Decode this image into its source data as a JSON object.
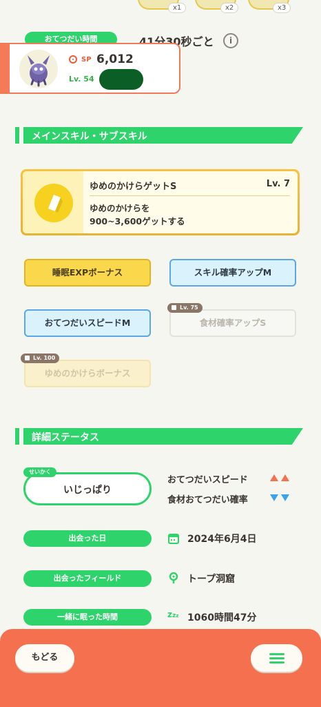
{
  "top": {
    "multipliers": [
      "x1",
      "x2",
      "x3"
    ],
    "help_label": "おてつだい時間",
    "help_value": "41分30秒ごと"
  },
  "pokemon": {
    "sp_label": "SP",
    "sp_value": "6,012",
    "level": "Lv. 54"
  },
  "skills_section": {
    "title": "メインスキル・サブスキル",
    "main_skill": {
      "name": "ゆめのかけらゲットS",
      "level": "Lv. 7",
      "desc_line1": "ゆめのかけらを",
      "desc_line2": "900~3,600ゲットする"
    },
    "sub_skills": [
      {
        "label": "睡眠EXPボーナス"
      },
      {
        "label": "スキル確率アップM"
      },
      {
        "label": "おてつだいスピードM"
      },
      {
        "label": "食材確率アップS",
        "lock": "Lv. 75"
      },
      {
        "label": "ゆめのかけらボーナス",
        "lock": "Lv. 100"
      }
    ]
  },
  "details": {
    "title": "詳細ステータス",
    "nature_tag": "せいかく",
    "nature": "いじっぱり",
    "nature_up": "おてつだいスピード",
    "nature_down": "食材おてつだい確率",
    "rows": [
      {
        "label": "出会った日",
        "value": "2024年6月4日"
      },
      {
        "label": "出会ったフィールド",
        "value": "トープ洞窟"
      },
      {
        "label": "一緒に眠った時間",
        "value": "1060時間47分"
      }
    ]
  },
  "footer": {
    "back_label": "もどる"
  },
  "colors": {
    "green": "#2fd36b",
    "orange": "#f5704f",
    "up_red": "#f5704f",
    "down_blue": "#3aa3f0"
  }
}
